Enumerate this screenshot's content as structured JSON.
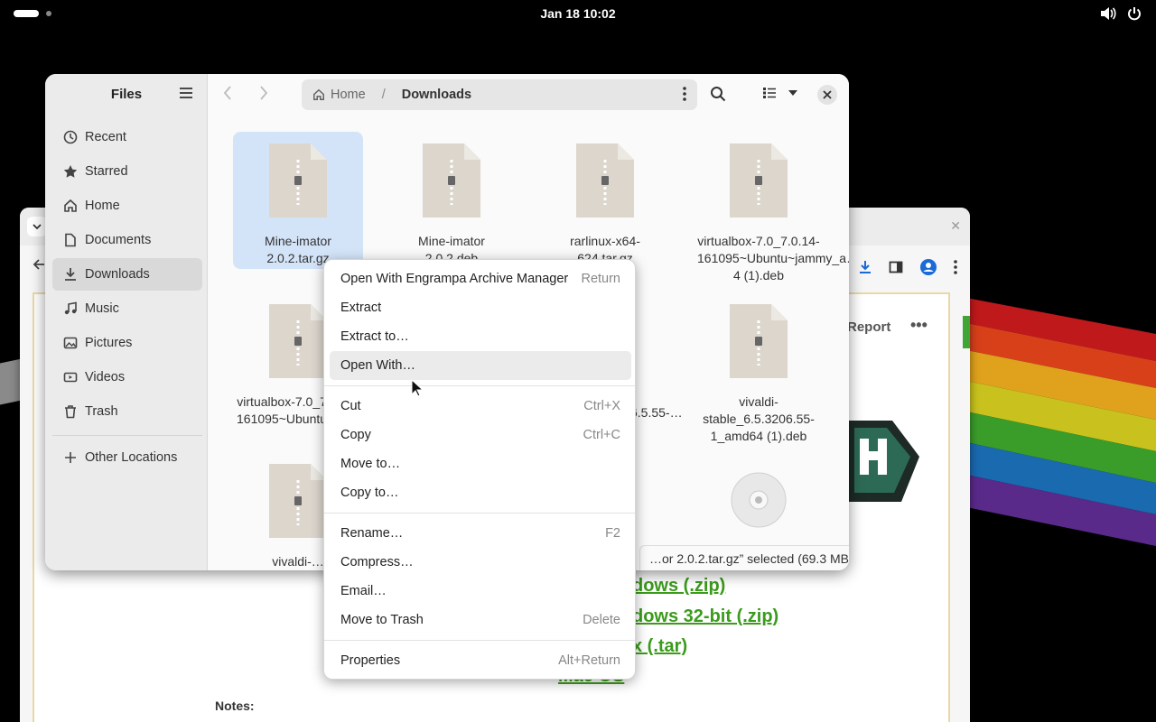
{
  "topbar": {
    "clock": "Jan 18  10:02"
  },
  "browser": {
    "report_label": "Report",
    "more_label": "•••",
    "links": [
      "dows (.zip)",
      "dows 32-bit (.zip)",
      "x (.tar)",
      "Mac OS"
    ],
    "notes_label": "Notes:"
  },
  "files": {
    "title": "Files",
    "sidebar": {
      "items": [
        {
          "label": "Recent",
          "icon": "clock-icon"
        },
        {
          "label": "Starred",
          "icon": "star-icon"
        },
        {
          "label": "Home",
          "icon": "home-icon"
        },
        {
          "label": "Documents",
          "icon": "document-icon"
        },
        {
          "label": "Downloads",
          "icon": "download-icon"
        },
        {
          "label": "Music",
          "icon": "music-icon"
        },
        {
          "label": "Pictures",
          "icon": "picture-icon"
        },
        {
          "label": "Videos",
          "icon": "video-icon"
        },
        {
          "label": "Trash",
          "icon": "trash-icon"
        }
      ],
      "other_locations": "Other Locations"
    },
    "path": {
      "home": "Home",
      "current": "Downloads"
    },
    "items": [
      {
        "label": "Mine-imator 2.0.2.tar.gz"
      },
      {
        "label": "Mine-imator 2.0.2.deb"
      },
      {
        "label": "rarlinux-x64-624.tar.gz"
      },
      {
        "label": "virtualbox-7.0_7.0.14-161095~Ubuntu~jammy_a… 4 (1).deb"
      },
      {
        "label": "virtualbox-7.0_7.0.14-161095~Ubuntu~jammy_amd64…"
      },
      {
        "label": "…6.5.55-…m"
      },
      {
        "label": "vivaldi-stable_6.5.3206.55-1_amd64 (1).deb"
      },
      {
        "label": "vivaldi-…"
      }
    ],
    "status": "…or 2.0.2.tar.gz” selected  (69.3 MB)"
  },
  "context_menu": {
    "groups": [
      [
        {
          "label": "Open With Engrampa Archive Manager",
          "accel": "Return"
        },
        {
          "label": "Extract",
          "accel": ""
        },
        {
          "label": "Extract to…",
          "accel": ""
        },
        {
          "label": "Open With…",
          "accel": ""
        }
      ],
      [
        {
          "label": "Cut",
          "accel": "Ctrl+X"
        },
        {
          "label": "Copy",
          "accel": "Ctrl+C"
        },
        {
          "label": "Move to…",
          "accel": ""
        },
        {
          "label": "Copy to…",
          "accel": ""
        }
      ],
      [
        {
          "label": "Rename…",
          "accel": "F2"
        },
        {
          "label": "Compress…",
          "accel": ""
        },
        {
          "label": "Email…",
          "accel": ""
        },
        {
          "label": "Move to Trash",
          "accel": "Delete"
        }
      ],
      [
        {
          "label": "Properties",
          "accel": "Alt+Return"
        }
      ]
    ]
  },
  "colors": {
    "accent_selection": "#d4e4f8",
    "link_green": "#3b9b1c"
  }
}
